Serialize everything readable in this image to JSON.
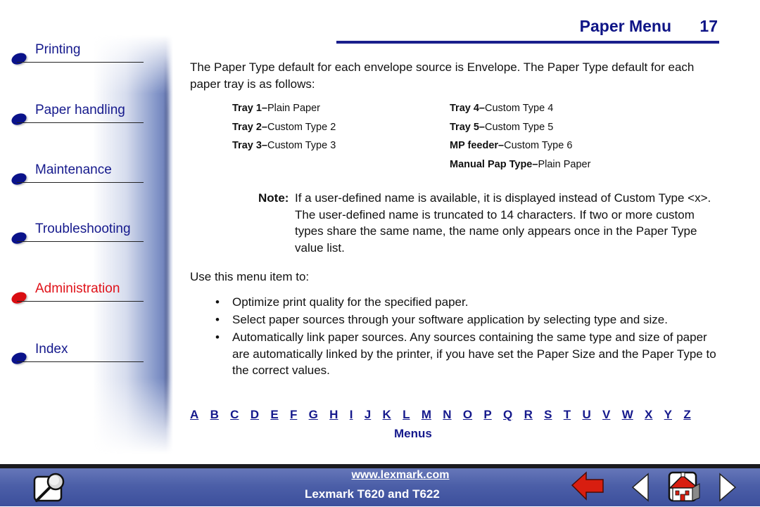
{
  "sidebar": {
    "items": [
      {
        "label": "Printing",
        "active": false
      },
      {
        "label": "Paper handling",
        "active": false
      },
      {
        "label": "Maintenance",
        "active": false
      },
      {
        "label": "Troubleshooting",
        "active": false
      },
      {
        "label": "Administration",
        "active": true
      },
      {
        "label": "Index",
        "active": false
      }
    ]
  },
  "header": {
    "title": "Paper Menu",
    "page_number": "17"
  },
  "content": {
    "intro": "The Paper Type default for each envelope source is Envelope. The Paper Type default for each paper tray is as follows:",
    "trays_left": [
      {
        "source": "Tray 1",
        "value": "Plain Paper"
      },
      {
        "source": "Tray 2",
        "value": "Custom Type 2"
      },
      {
        "source": "Tray 3",
        "value": "Custom Type 3"
      }
    ],
    "trays_right": [
      {
        "source": "Tray 4",
        "value": "Custom Type 4"
      },
      {
        "source": "Tray 5",
        "value": "Custom Type 5"
      },
      {
        "source": "MP feeder",
        "value": "Custom Type 6"
      },
      {
        "source": "Manual Pap Type",
        "value": "Plain Paper"
      }
    ],
    "separator": "–",
    "note_label": "Note:",
    "note_text": "If a user-defined name is available, it is displayed instead of Custom Type <x>. The user-defined name is truncated to 14 characters. If two or more custom types share the same name, the name only appears once in the Paper Type value list.",
    "use_intro": "Use this menu item to:",
    "bullet_glyph": "•",
    "bullets": [
      "Optimize print quality for the specified paper.",
      "Select paper sources through your software application by selecting type and size.",
      "Automatically link paper sources. Any sources containing the same type and size of paper are automatically linked by the printer, if you have set the Paper Size and the Paper Type to the correct values."
    ]
  },
  "alphabet": [
    "A",
    "B",
    "C",
    "D",
    "E",
    "F",
    "G",
    "H",
    "I",
    "J",
    "K",
    "L",
    "M",
    "N",
    "O",
    "P",
    "Q",
    "R",
    "S",
    "T",
    "U",
    "V",
    "W",
    "X",
    "Y",
    "Z"
  ],
  "menus_link": "Menus",
  "footer": {
    "url": "www.lexmark.com",
    "product": "Lexmark T620 and T622",
    "icons": [
      "search-icon",
      "back-arrow-icon",
      "previous-page-icon",
      "home-icon",
      "next-page-icon"
    ]
  },
  "colors": {
    "nav_blue": "#15198c",
    "active_red": "#e0131a",
    "header_blue": "#0e1486",
    "footer_blue": "#4c5fa8"
  }
}
